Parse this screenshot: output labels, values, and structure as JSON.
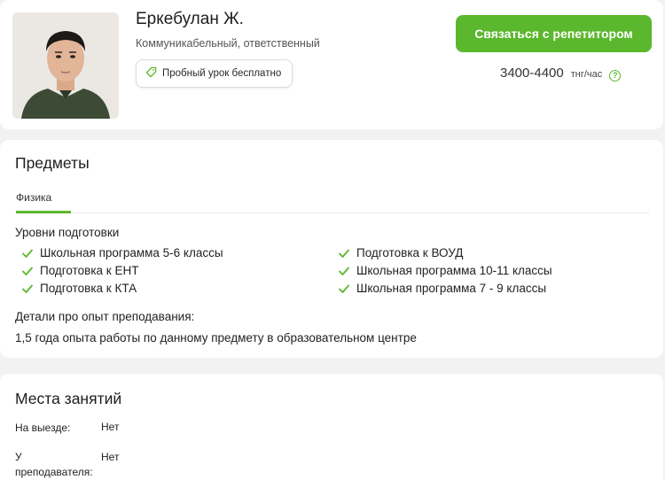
{
  "profile": {
    "name": "Еркебулан Ж.",
    "description": "Коммуникабельный, ответственный",
    "trial_badge": "Пробный урок бесплатно",
    "contact_button": "Связаться с репетитором",
    "price": "3400-4400",
    "price_unit": "тнг/час",
    "accent_color": "#5bb72d",
    "photo_icon": "tutor-photo"
  },
  "subjects": {
    "title": "Предметы",
    "tabs": [
      "Физика"
    ],
    "levels_label": "Уровни подготовки",
    "levels_left": [
      "Школьная программа 5-6 классы",
      "Подготовка к ЕНТ",
      "Подготовка к КТА"
    ],
    "levels_right": [
      "Подготовка к ВОУД",
      "Школьная программа 10-11 классы",
      "Школьная программа 7 - 9 классы"
    ],
    "details_label": "Детали про опыт преподавания:",
    "details_text": "1,5 года опыта работы по данному предмету в образовательном центре"
  },
  "places": {
    "title": "Места занятий",
    "rows": [
      {
        "label": "На выезде:",
        "value": "Нет"
      },
      {
        "label": "У преподавателя:",
        "value": "Нет"
      }
    ]
  }
}
